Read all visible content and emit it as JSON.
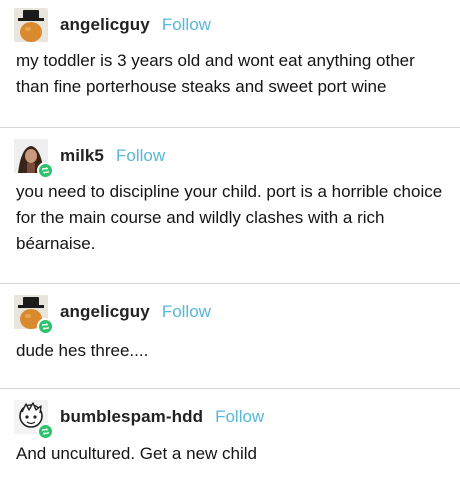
{
  "accent_colors": {
    "follow_link": "#58b8d8",
    "reblog_badge": "#2dc26b",
    "divider": "#d6d6d6"
  },
  "posts": [
    {
      "avatar_icon": "avatar-black-hat-orange",
      "username": "angelicguy",
      "follow_label": "Follow",
      "has_reblog_badge": false,
      "text": "my toddler is 3 years old and wont eat anything other than fine porterhouse steaks and sweet port wine"
    },
    {
      "avatar_icon": "avatar-person-photo",
      "username": "milk5",
      "follow_label": "Follow",
      "has_reblog_badge": true,
      "text": "you need to discipline your child. port is a horrible choice for the main course and wildly clashes with a rich béarnaise."
    },
    {
      "avatar_icon": "avatar-black-hat-orange",
      "username": "angelicguy",
      "follow_label": "Follow",
      "has_reblog_badge": true,
      "text": "dude hes three...."
    },
    {
      "avatar_icon": "avatar-cartoon-character",
      "username": "bumblespam-hdd",
      "follow_label": "Follow",
      "has_reblog_badge": true,
      "text": "And uncultured. Get a new child"
    }
  ]
}
